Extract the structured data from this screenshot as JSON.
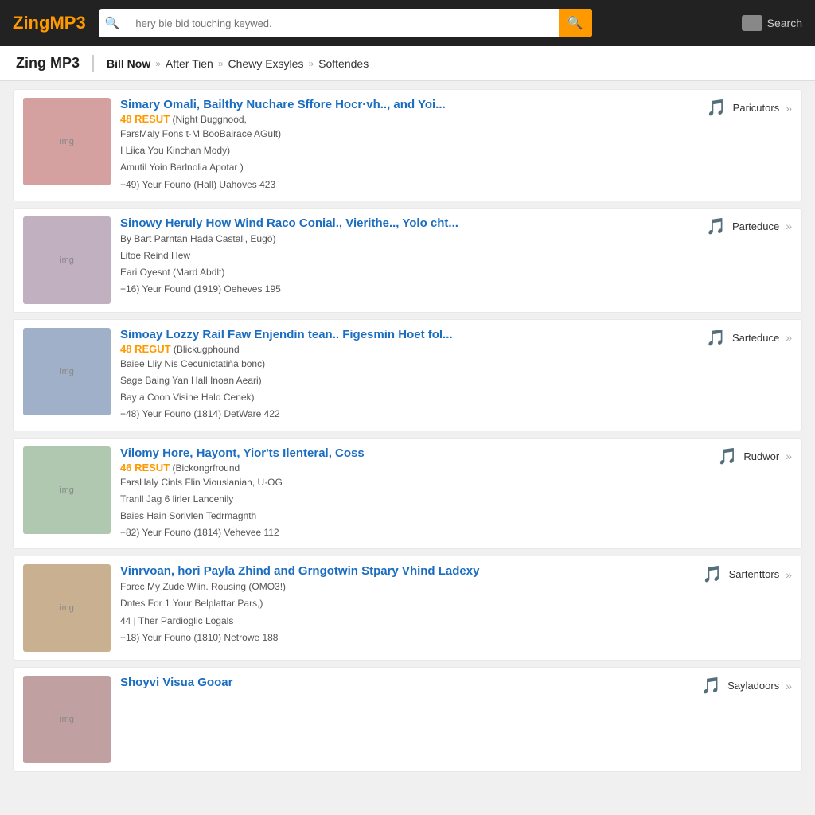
{
  "header": {
    "logo_zing": "Zing",
    "logo_mp3": "MP3",
    "search_placeholder": "hery bie bid touching keywed.",
    "search_button_icon": "🔍",
    "header_search_label": "Search"
  },
  "breadcrumb": {
    "brand": "Zing MP3",
    "items": [
      {
        "label": "Bill Now",
        "active": true
      },
      {
        "sep": "»"
      },
      {
        "label": "After Tien"
      },
      {
        "sep": "»"
      },
      {
        "label": "Chewy Exsyles"
      },
      {
        "sep": "»"
      },
      {
        "label": "Softendes"
      }
    ]
  },
  "results": [
    {
      "id": 1,
      "title": "Simary Omali, Bailthy Nuchare Sffore Hocr·vh.., and Yoi...",
      "badge": "48 RESUT",
      "badge_sub": "Night Buggnood,",
      "lines": [
        "FarsMaly Fons t·M BooBairace AGult)",
        "I Liica You Kinchan Mody)",
        "Amutil Yoin Barlnolia Apotar )",
        "+49) Yeur Founo (Hall) Uahoves 423"
      ],
      "action_label": "Paricutors"
    },
    {
      "id": 2,
      "title": "Sinowy Heruly How Wind Raco Conial., Vierithe.., Yolo cht...",
      "badge": "",
      "badge_sub": "",
      "lines": [
        "By Bart Parntan Hada Castall, Eugō)",
        "Litoe Reind Hew",
        "Eari Oyesnt (Mard Abdlt)",
        "+16) Yeur Found (1919) Oeheves 195"
      ],
      "action_label": "Parteduce"
    },
    {
      "id": 3,
      "title": "Simoay Lozzy Rail Faw Enjendin tean.. Figesmin Hoet fol...",
      "badge": "48 REGUT",
      "badge_sub": "Blickugphound",
      "lines": [
        "Baiee Lliy Nis Cecunictatiṅa bonc)",
        "Sage Baing Yan Hall Inoan Aeari)",
        "Bay a Coon Visine Halo Cenek)",
        "+48) Yeur Founo (1814) DetWare 422"
      ],
      "action_label": "Sarteduce"
    },
    {
      "id": 4,
      "title": "Vilomy Hore, Hayont, Yior'ts Ilenteral, Coss",
      "badge": "46 RESUT",
      "badge_sub": "Bickongrfround",
      "lines": [
        "FarsHaly Cinls Flin Viouslanian, U·OG",
        "Tranll Jag 6 lirler Lancenily",
        "Baies Hain Sorivlen Tedrmagnth",
        "+82) Yeur Founo (1814) Vehevee 112"
      ],
      "action_label": "Rudwor"
    },
    {
      "id": 5,
      "title": "Vinrvoan, hori Payla Zhind and Grngotwin Stpary Vhind Ladexy",
      "badge": "",
      "badge_sub": "",
      "lines": [
        "Farec My Zude Wiin. Rousing (OMO3!)",
        "Dntes For 1 Your Belplattar Pars,)",
        "44 | Ther Pardioglic Logals",
        "+18) Yeur Founo (1810) Netrowe 188"
      ],
      "action_label": "Sartenttors"
    },
    {
      "id": 6,
      "title": "Shoyvi Visua Gooar",
      "badge": "",
      "badge_sub": "",
      "lines": [],
      "action_label": "Sayladoors"
    }
  ]
}
